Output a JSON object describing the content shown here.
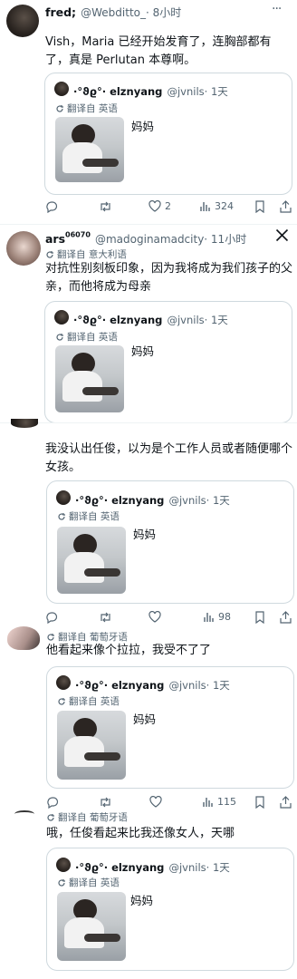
{
  "tweets": [
    {
      "name": "fred;",
      "handle": "@Webditto_",
      "time": "· 8小时",
      "translated": "",
      "text": "Vish，Maria 已经开始发育了，连胸部都有了，真是 Perlutan 本尊啊。",
      "quote": {
        "name": "·°ϑϱ°· elznyang",
        "handle": "@jvnils",
        "time": "· 1天",
        "translated": "翻译自 英语",
        "text": "妈妈"
      },
      "actions": {
        "replies": "",
        "retweets": "",
        "likes": "2",
        "views": "324"
      }
    },
    {
      "name": "ars",
      "name_sup": "06070",
      "handle": "@madoginamadcity",
      "time": "· 11小时",
      "translated": "翻译自 意大利语",
      "text": "对抗性别刻板印象，因为我将成为我们孩子的父亲，而他将成为母亲",
      "quote": {
        "name": "·°ϑϱ°· elznyang",
        "handle": "@jvnils",
        "time": "· 1天",
        "translated": "翻译自 英语",
        "text": "妈妈"
      }
    },
    {
      "name": "",
      "handle": "",
      "time": "",
      "translated": "",
      "text": "我没认出任俊，以为是个工作人员或者随便哪个女孩。",
      "quote": {
        "name": "·°ϑϱ°· elznyang",
        "handle": "@jvnils",
        "time": "· 1天",
        "translated": "翻译自 英语",
        "text": "妈妈"
      }
    },
    {
      "translated": "翻译自 葡萄牙语",
      "text": "他看起来像个拉拉，我受不了了",
      "quote": {
        "name": "·°ϑϱ°· elznyang",
        "handle": "@jvnils",
        "time": "· 1天",
        "translated": "翻译自 英语",
        "text": "妈妈"
      },
      "actions_above": {
        "views": "98"
      },
      "actions": {
        "views": "115"
      }
    },
    {
      "translated": "翻译自 葡萄牙语",
      "text": "哦，任俊看起来比我还像女人，天哪",
      "quote": {
        "name": "·°ϑϱ°· elznyang",
        "handle": "@jvnils",
        "time": "· 1天",
        "translated": "翻译自 英语",
        "text": "妈妈"
      }
    }
  ],
  "icons": {
    "x_logo": "X",
    "more": "···",
    "verified_color": "#1d9bf0"
  },
  "colors": {
    "text": "#0f1419",
    "secondary": "#536471",
    "border": "#cfd9de"
  }
}
